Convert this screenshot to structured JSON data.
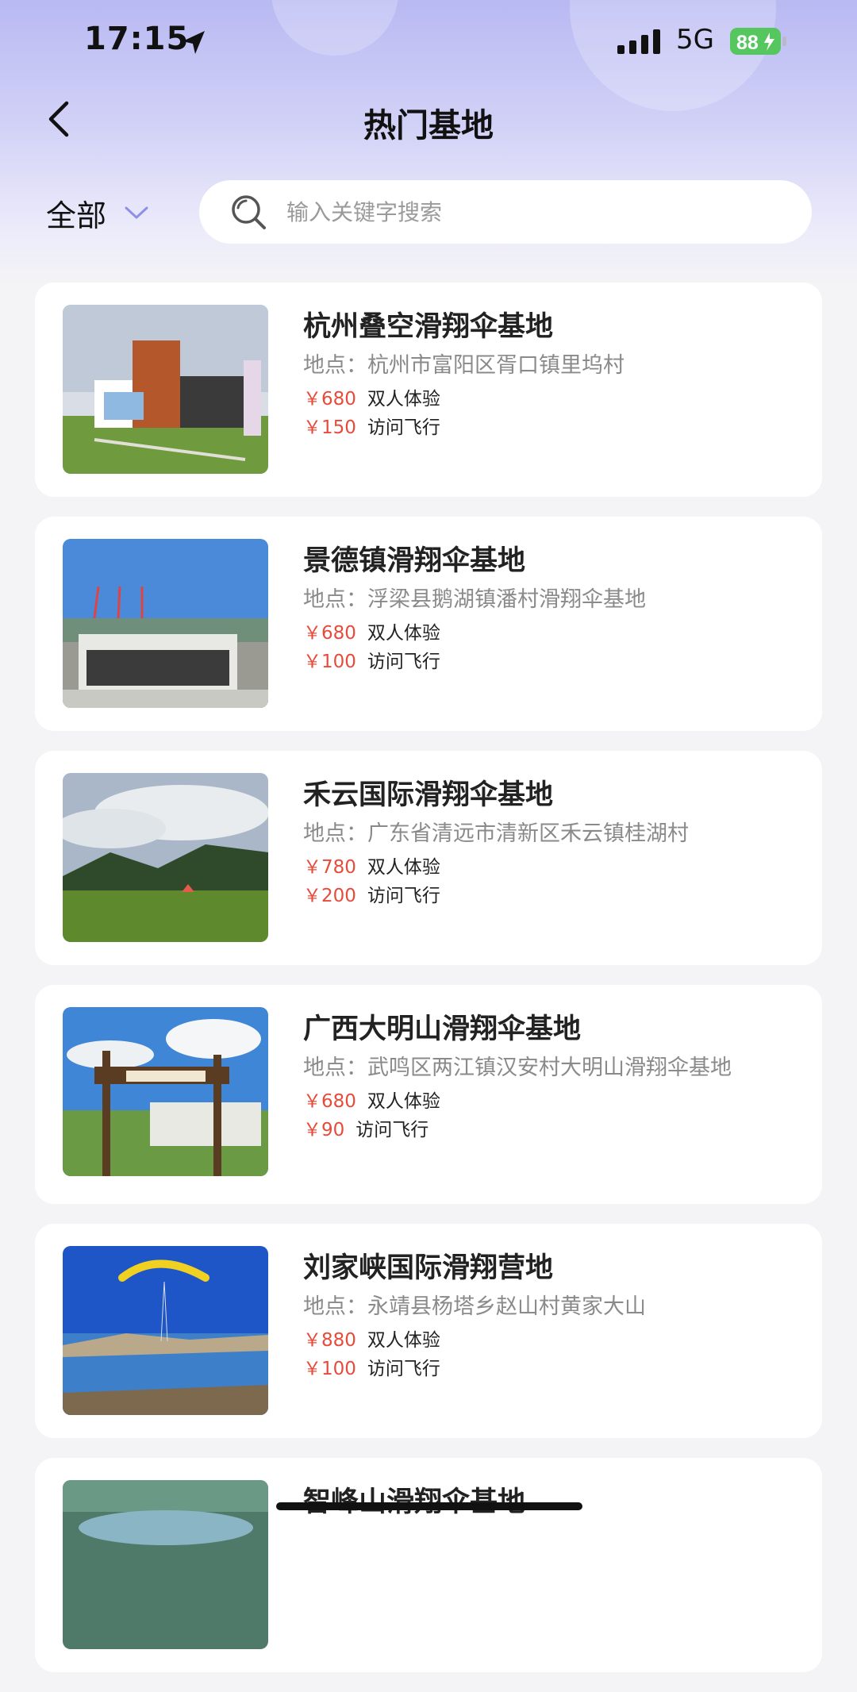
{
  "status_bar": {
    "time": "17:15",
    "network": "5G",
    "battery": "88"
  },
  "header": {
    "title": "热门基地"
  },
  "filter": {
    "label": "全部"
  },
  "search": {
    "placeholder": "输入关键字搜索"
  },
  "bases": [
    {
      "name": "杭州叠空滑翔伞基地",
      "address": "地点：杭州市富阳区胥口镇里坞村",
      "prices": [
        {
          "price": "￥680",
          "type": "双人体验"
        },
        {
          "price": "￥150",
          "type": "访问飞行"
        }
      ]
    },
    {
      "name": "景德镇滑翔伞基地",
      "address": "地点：浮梁县鹅湖镇潘村滑翔伞基地",
      "prices": [
        {
          "price": "￥680",
          "type": "双人体验"
        },
        {
          "price": "￥100",
          "type": "访问飞行"
        }
      ]
    },
    {
      "name": "禾云国际滑翔伞基地",
      "address": "地点：广东省清远市清新区禾云镇桂湖村",
      "prices": [
        {
          "price": "￥780",
          "type": "双人体验"
        },
        {
          "price": "￥200",
          "type": "访问飞行"
        }
      ]
    },
    {
      "name": "广西大明山滑翔伞基地",
      "address": "地点：武鸣区两江镇汉安村大明山滑翔伞基地",
      "prices": [
        {
          "price": "￥680",
          "type": "双人体验"
        },
        {
          "price": "￥90",
          "type": "访问飞行"
        }
      ]
    },
    {
      "name": "刘家峡国际滑翔营地",
      "address": "地点：永靖县杨塔乡赵山村黄家大山",
      "prices": [
        {
          "price": "￥880",
          "type": "双人体验"
        },
        {
          "price": "￥100",
          "type": "访问飞行"
        }
      ]
    },
    {
      "name": "智峰山滑翔伞基地"
    }
  ],
  "colors": {
    "price": "#e64b3b",
    "header_gradient_top": "#b9b9f3",
    "accent": "#8f8fe6"
  }
}
